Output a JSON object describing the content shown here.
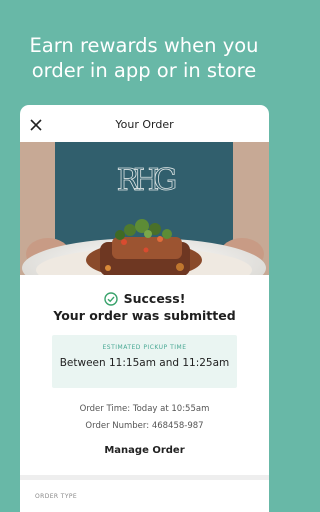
{
  "headline": {
    "line1": "Earn rewards when you",
    "line2": "order in app or in store"
  },
  "header": {
    "title": "Your Order"
  },
  "icons": {
    "close": "close-icon",
    "success": "check-circle-icon"
  },
  "hero": {
    "monogram": "RHG"
  },
  "confirmation": {
    "success": "Success!",
    "message": "Your order was submitted"
  },
  "pickup": {
    "label": "ESTIMATED PICKUP TIME",
    "time": "Between 11:15am and 11:25am"
  },
  "details": {
    "order_time": "Order Time: Today at 10:55am",
    "order_number": "Order Number: 468458-987"
  },
  "actions": {
    "manage": "Manage Order"
  },
  "sections": {
    "order_type": "ORDER TYPE"
  },
  "colors": {
    "brand": "#68b8a7",
    "success": "#3aa36c",
    "accent_text": "#48a894",
    "panel": "#eaf5f2"
  }
}
